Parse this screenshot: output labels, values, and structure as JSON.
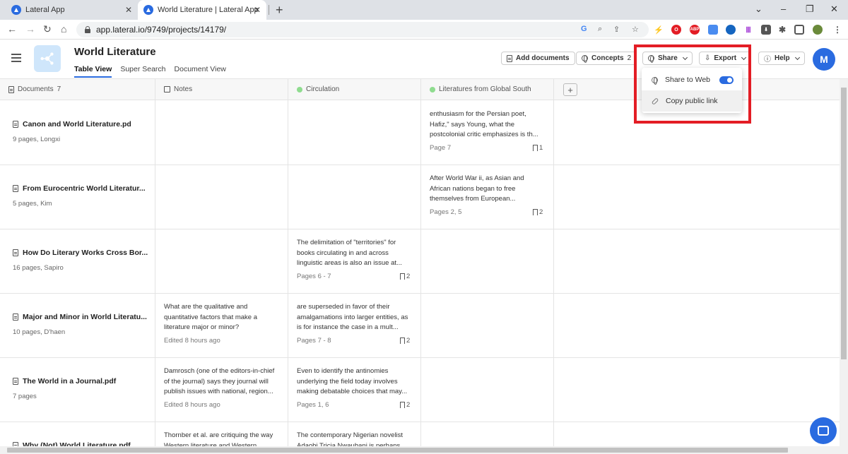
{
  "browser": {
    "tabs": [
      {
        "title": "Lateral App",
        "active": false
      },
      {
        "title": "World Literature | Lateral App",
        "active": true
      }
    ],
    "url": "app.lateral.io/9749/projects/14179/"
  },
  "header": {
    "project_title": "World Literature",
    "view_tabs": [
      "Table View",
      "Super Search",
      "Document View"
    ],
    "active_view": "Table View",
    "add_documents": "Add documents",
    "concepts_label": "Concepts",
    "concepts_count": "2",
    "share_label": "Share",
    "export_label": "Export",
    "help_label": "Help",
    "avatar_initial": "M"
  },
  "share_menu": {
    "share_to_web": "Share to Web",
    "share_to_web_enabled": true,
    "copy_public_link": "Copy public link"
  },
  "columns": {
    "documents_label": "Documents",
    "documents_count": "7",
    "notes": "Notes",
    "circulation": "Circulation",
    "global_south": "Literatures from Global South"
  },
  "rows": [
    {
      "title": "Canon and World Literature.pd",
      "meta": "9 pages, Longxi",
      "notes": null,
      "circulation": null,
      "south": {
        "text": "enthusiasm for the Persian poet, Hafiz,\" says Young, what the postcolonial critic emphasizes is th...",
        "pages": "Page 7",
        "count": "1"
      }
    },
    {
      "title": "From Eurocentric World Literatur...",
      "meta": "5 pages, Kim",
      "notes": null,
      "circulation": null,
      "south": {
        "text": "After World War ii, as Asian and African nations began to free themselves from European...",
        "pages": "Pages 2, 5",
        "count": "2"
      }
    },
    {
      "title": "How Do Literary Works Cross Bor...",
      "meta": "16 pages, Sapiro",
      "notes": null,
      "circulation": {
        "text": "The delimitation of \"territories\" for books circulating in and across linguistic areas is also an issue at...",
        "pages": "Pages 6 - 7",
        "count": "2"
      },
      "south": null
    },
    {
      "title": "Major and Minor in World Literatu...",
      "meta": "10 pages, D'haen",
      "notes": {
        "text": "What are the qualitative and quantitative factors that make a literature major or minor?",
        "edited": "Edited 8 hours ago"
      },
      "circulation": {
        "text": "are superseded in favor of their amalgamations into larger entities, as is for instance the case in a mult...",
        "pages": "Pages 7 - 8",
        "count": "2"
      },
      "south": null
    },
    {
      "title": "The World in a Journal.pdf",
      "meta": "7 pages",
      "notes": {
        "text": "Damrosch (one of the editors-in-chief of the journal) says they journal will publish issues with national, region...",
        "edited": "Edited 8 hours ago"
      },
      "circulation": {
        "text": "Even to identify the antinomies underlying the field today involves making debatable choices that may...",
        "pages": "Pages 1, 6",
        "count": "2"
      },
      "south": null
    },
    {
      "title": "Why (Not) World Literature.pdf",
      "meta": "",
      "notes": {
        "text": "Thornber et al. are critiquing the way Western literature and Western",
        "edited": ""
      },
      "circulation": {
        "text": "The contemporary Nigerian novelist Adaobi Tricia Nwaubani is perhaps",
        "pages": "",
        "count": ""
      },
      "south": null
    }
  ]
}
